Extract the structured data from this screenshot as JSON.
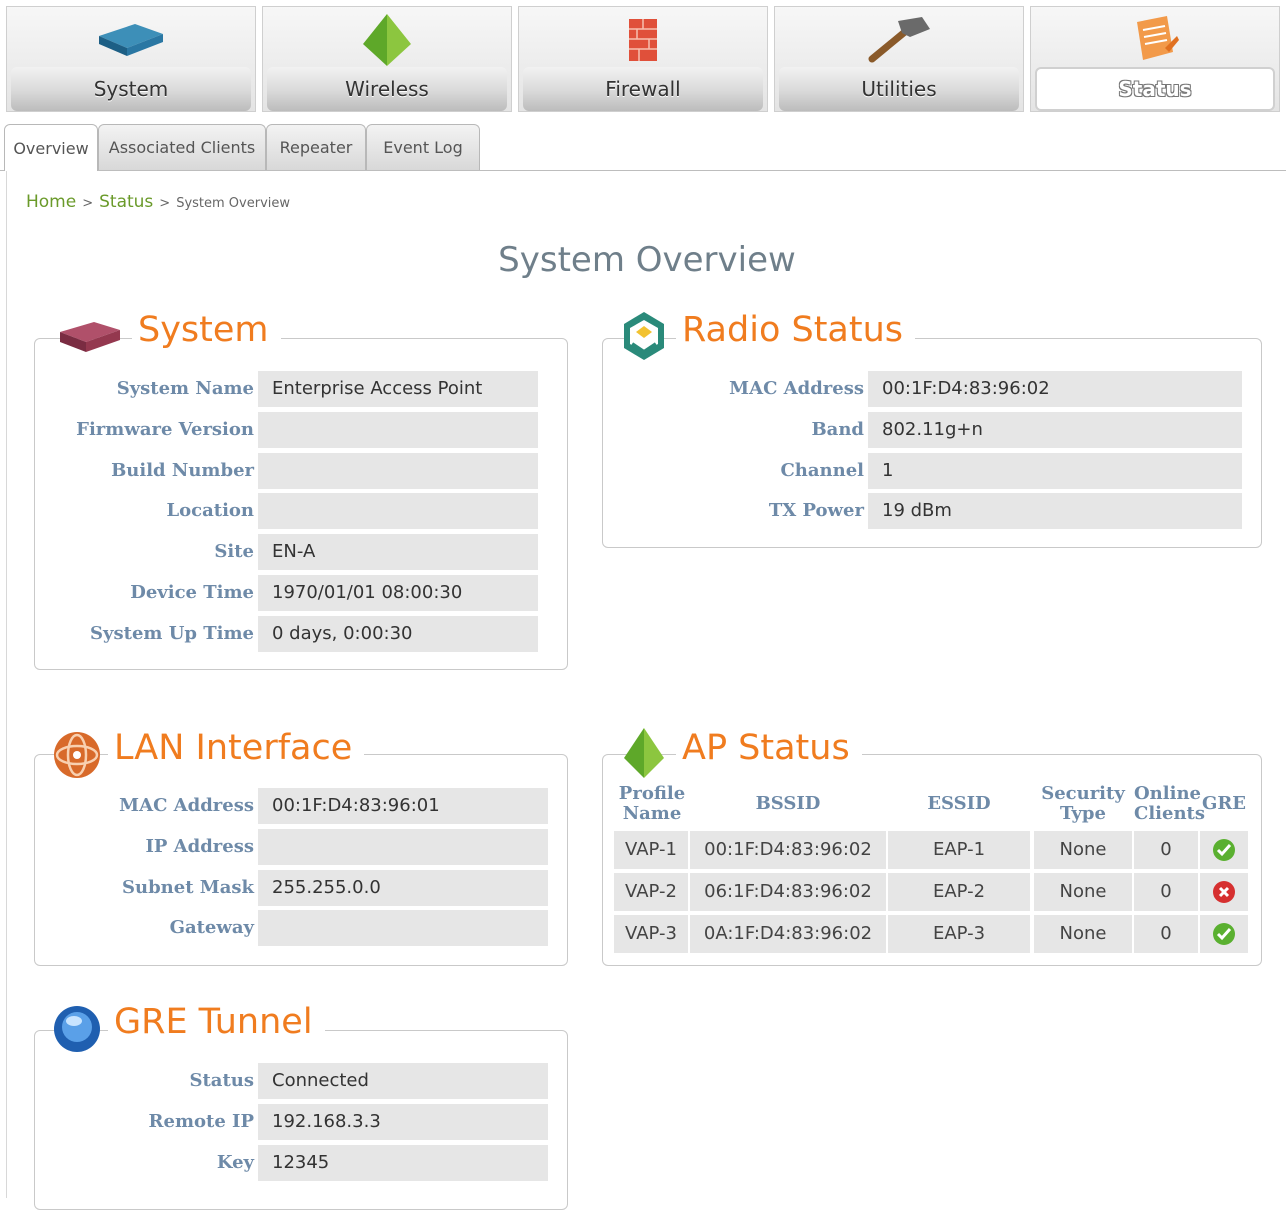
{
  "nav": {
    "items": [
      {
        "label": "System",
        "icon": "router-icon"
      },
      {
        "label": "Wireless",
        "icon": "pyramid-icon"
      },
      {
        "label": "Firewall",
        "icon": "firewall-icon"
      },
      {
        "label": "Utilities",
        "icon": "hammer-icon"
      },
      {
        "label": "Status",
        "icon": "notepad-icon",
        "active": true
      }
    ]
  },
  "tabs": [
    {
      "label": "Overview",
      "active": true
    },
    {
      "label": "Associated Clients"
    },
    {
      "label": "Repeater"
    },
    {
      "label": "Event Log"
    }
  ],
  "breadcrumb": {
    "home": "Home",
    "sep1": ">",
    "status": "Status",
    "sep2": ">",
    "current": "System Overview"
  },
  "page_title": "System Overview",
  "system": {
    "title": "System",
    "rows": [
      {
        "label": "System Name",
        "value": "Enterprise Access Point"
      },
      {
        "label": "Firmware Version",
        "value": ""
      },
      {
        "label": "Build Number",
        "value": ""
      },
      {
        "label": "Location",
        "value": ""
      },
      {
        "label": "Site",
        "value": "EN-A"
      },
      {
        "label": "Device Time",
        "value": "1970/01/01 08:00:30"
      },
      {
        "label": "System Up Time",
        "value": "0 days, 0:00:30"
      }
    ]
  },
  "radio": {
    "title": "Radio Status",
    "rows": [
      {
        "label": "MAC Address",
        "value": "00:1F:D4:83:96:02"
      },
      {
        "label": "Band",
        "value": "802.11g+n"
      },
      {
        "label": "Channel",
        "value": "1"
      },
      {
        "label": "TX Power",
        "value": "19 dBm"
      }
    ]
  },
  "lan": {
    "title": "LAN Interface",
    "rows": [
      {
        "label": "MAC Address",
        "value": "00:1F:D4:83:96:01"
      },
      {
        "label": "IP Address",
        "value": ""
      },
      {
        "label": "Subnet Mask",
        "value": "255.255.0.0"
      },
      {
        "label": "Gateway",
        "value": ""
      }
    ]
  },
  "ap": {
    "title": "AP Status",
    "headers": {
      "profile": "Profile Name",
      "bssid": "BSSID",
      "essid": "ESSID",
      "security": "Security Type",
      "online": "Online Clients",
      "gre": "GRE"
    },
    "rows": [
      {
        "profile": "VAP-1",
        "bssid": "00:1F:D4:83:96:02",
        "essid": "EAP-1",
        "security": "None",
        "online": "0",
        "gre": "ok"
      },
      {
        "profile": "VAP-2",
        "bssid": "06:1F:D4:83:96:02",
        "essid": "EAP-2",
        "security": "None",
        "online": "0",
        "gre": "error"
      },
      {
        "profile": "VAP-3",
        "bssid": "0A:1F:D4:83:96:02",
        "essid": "EAP-3",
        "security": "None",
        "online": "0",
        "gre": "ok"
      }
    ]
  },
  "gre": {
    "title": "GRE Tunnel",
    "rows": [
      {
        "label": "Status",
        "value": "Connected"
      },
      {
        "label": "Remote IP",
        "value": "192.168.3.3"
      },
      {
        "label": "Key",
        "value": "12345"
      }
    ]
  },
  "colors": {
    "accent": "#f07c1f",
    "label": "#6e8aa8",
    "breadcrumb": "#6a9a2a",
    "ok": "#5ab030",
    "error": "#d63030"
  }
}
